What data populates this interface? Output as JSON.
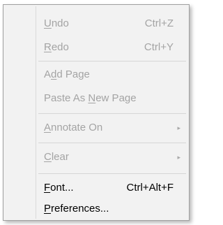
{
  "menu": {
    "items": [
      {
        "pre": "",
        "key": "U",
        "post": "ndo",
        "shortcut": "Ctrl+Z",
        "enabled": false
      },
      {
        "pre": "",
        "key": "R",
        "post": "edo",
        "shortcut": "Ctrl+Y",
        "enabled": false
      },
      {
        "pre": "A",
        "key": "d",
        "post": "d Page",
        "shortcut": "",
        "enabled": false
      },
      {
        "pre": "Paste As ",
        "key": "N",
        "post": "ew Page",
        "shortcut": "",
        "enabled": false
      },
      {
        "pre": "",
        "key": "A",
        "post": "nnotate On",
        "shortcut": "",
        "enabled": false,
        "submenu_icon": "submenu-arrow-icon"
      },
      {
        "pre": "",
        "key": "C",
        "post": "lear",
        "shortcut": "",
        "enabled": false,
        "submenu_icon": "submenu-arrow-icon"
      },
      {
        "pre": "",
        "key": "F",
        "post": "ont...",
        "shortcut": "Ctrl+Alt+F",
        "enabled": true
      },
      {
        "pre": "",
        "key": "P",
        "post": "references...",
        "shortcut": "",
        "enabled": true
      }
    ],
    "arrow_glyph": "▸",
    "colors": {
      "background": "#f2f2f2",
      "disabled_text": "#a4a4a4",
      "enabled_text": "#000000",
      "separator": "#d6d6d6"
    }
  }
}
